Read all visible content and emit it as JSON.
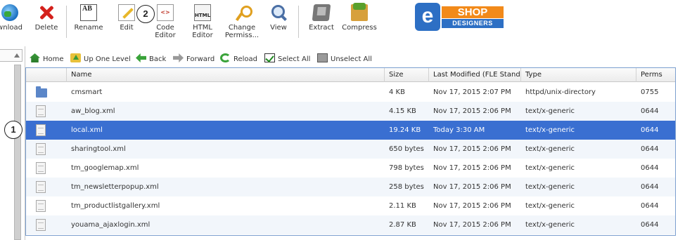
{
  "toolbar": {
    "download_label": "wnload",
    "delete_label": "Delete",
    "rename_label": "Rename",
    "rename_icon_text": "AB",
    "edit_label": "Edit",
    "code_editor_label_1": "Code",
    "code_editor_label_2": "Editor",
    "code_icon_text": "<>",
    "html_editor_label_1": "HTML",
    "html_editor_label_2": "Editor",
    "html_icon_text": "HTML",
    "change_perms_label_1": "Change",
    "change_perms_label_2": "Permiss...",
    "view_label": "View",
    "extract_label": "Extract",
    "compress_label": "Compress"
  },
  "logo": {
    "letter": "e",
    "line1": "SHOP",
    "line2": "DESIGNERS"
  },
  "markers": {
    "one": "1",
    "two": "2"
  },
  "nav": {
    "home": "Home",
    "up_one_level": "Up One Level",
    "back": "Back",
    "forward": "Forward",
    "reload": "Reload",
    "select_all": "Select All",
    "unselect_all": "Unselect All"
  },
  "table": {
    "columns": {
      "name": "Name",
      "size": "Size",
      "last_modified": "Last Modified (FLE Standard",
      "type": "Type",
      "perms": "Perms"
    },
    "rows": [
      {
        "icon": "folder-icon",
        "name": "cmsmart",
        "size": "4 KB",
        "modified": "Nov 17, 2015 2:07 PM",
        "type": "httpd/unix-directory",
        "perms": "0755"
      },
      {
        "icon": "file-icon",
        "name": "aw_blog.xml",
        "size": "4.15 KB",
        "modified": "Nov 17, 2015 2:06 PM",
        "type": "text/x-generic",
        "perms": "0644"
      },
      {
        "icon": "file-icon",
        "name": "local.xml",
        "size": "19.24 KB",
        "modified": "Today 3:30 AM",
        "type": "text/x-generic",
        "perms": "0644"
      },
      {
        "icon": "file-icon",
        "name": "sharingtool.xml",
        "size": "650 bytes",
        "modified": "Nov 17, 2015 2:06 PM",
        "type": "text/x-generic",
        "perms": "0644"
      },
      {
        "icon": "file-icon",
        "name": "tm_googlemap.xml",
        "size": "798 bytes",
        "modified": "Nov 17, 2015 2:06 PM",
        "type": "text/x-generic",
        "perms": "0644"
      },
      {
        "icon": "file-icon",
        "name": "tm_newsletterpopup.xml",
        "size": "258 bytes",
        "modified": "Nov 17, 2015 2:06 PM",
        "type": "text/x-generic",
        "perms": "0644"
      },
      {
        "icon": "file-icon",
        "name": "tm_productlistgallery.xml",
        "size": "2.11 KB",
        "modified": "Nov 17, 2015 2:06 PM",
        "type": "text/x-generic",
        "perms": "0644"
      },
      {
        "icon": "file-icon",
        "name": "youama_ajaxlogin.xml",
        "size": "2.87 KB",
        "modified": "Nov 17, 2015 2:06 PM",
        "type": "text/x-generic",
        "perms": "0644"
      }
    ],
    "selected_row": "local.xml"
  },
  "colors": {
    "selected_row": "#3a6fd1",
    "table_border": "#7c9fcf",
    "logo_orange": "#f28a1a",
    "logo_blue": "#2d6fc4"
  }
}
